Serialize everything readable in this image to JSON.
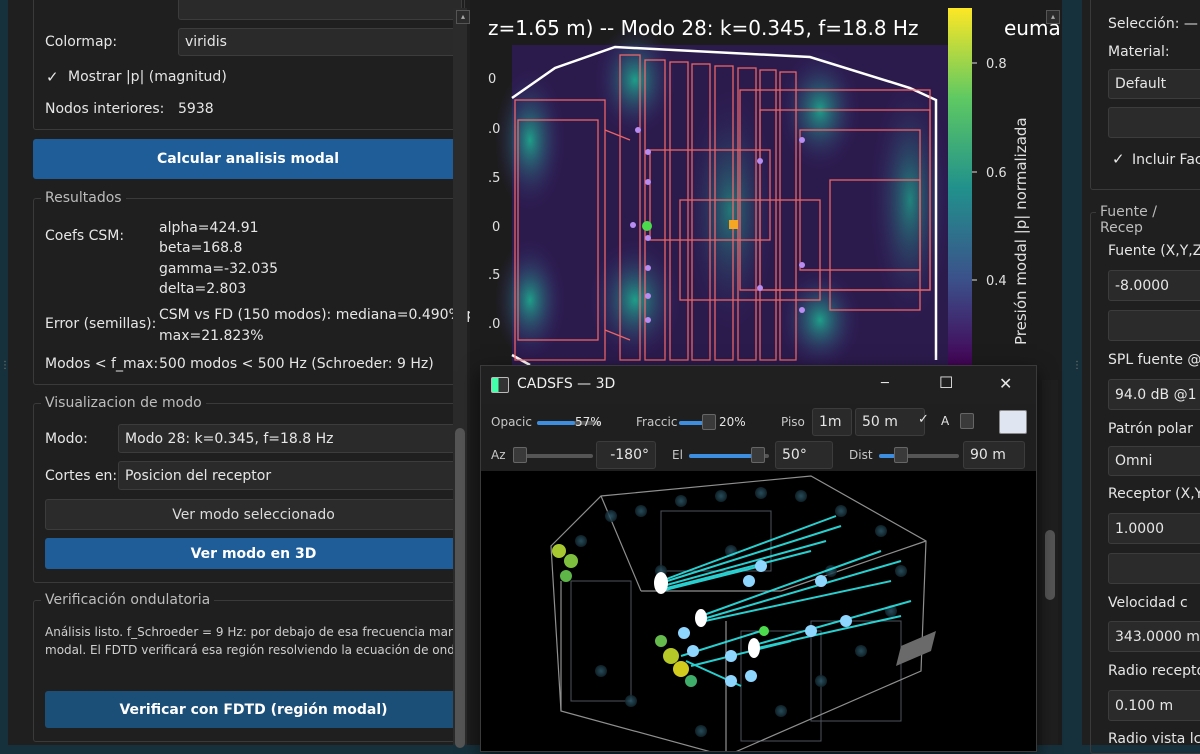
{
  "left": {
    "colormap_label": "Colormap:",
    "colormap_value": "viridis",
    "show_mag_label": "Mostrar |p| (magnitud)",
    "interior_nodes_label": "Nodos interiores:",
    "interior_nodes_value": "5938",
    "calc_button": "Calcular analisis modal",
    "results_title": "Resultados",
    "csm_label": "Coefs CSM:",
    "csm_values": [
      "alpha=424.91",
      "beta=168.8",
      "gamma=-32.035",
      "delta=2.803"
    ],
    "error_label": "Error (semillas):",
    "error_line1": "CSM vs FD (150 modos): mediana=0.490%  p",
    "error_line2": "max=21.823%",
    "modes_label": "Modos < f_max:",
    "modes_value": "500 modos < 500 Hz  (Schroeder: 9 Hz)",
    "viz_title": "Visualizacion de modo",
    "mode_label": "Modo:",
    "mode_value": "Modo 28: k=0.345, f=18.8 Hz",
    "cuts_label": "Cortes en:",
    "cuts_value": "Posicion del receptor",
    "view_mode_button": "Ver modo seleccionado",
    "view_3d_button": "Ver modo en 3D",
    "verif_title": "Verificación ondulatoria",
    "verif_line1": "Análisis listo. f_Schroeder = 9 Hz: por debajo de esa frecuencia man",
    "verif_line2": "modal. El FDTD verificará esa región resolviendo la ecuación de ond",
    "fdtd_button": "Verificar con FDTD (región modal)"
  },
  "plot": {
    "title": "z=1.65 m) -- Modo 28: k=0.345, f=18.8 Hz",
    "title_right": "eumar",
    "yticks": [
      ".0",
      ".5",
      "0",
      ".5",
      ".0"
    ],
    "colorbar_ticks": [
      "0.8",
      "0.6",
      "0.4"
    ],
    "colorbar_label": "Presión modal |p| normalizada"
  },
  "win3d": {
    "title": "CADSFS — 3D",
    "opacity_label": "Opacic",
    "opacity_value": "57%",
    "fraction_label": "Fraccic",
    "fraction_value": "20%",
    "floor_label": "Piso",
    "floor_step": "1m",
    "floor_value": "50 m",
    "a_label": "A",
    "az_label": "Az",
    "az_value": "-180°",
    "el_label": "El",
    "el_value": "50°",
    "dist_label": "Dist",
    "dist_value": "90 m",
    "colors": {
      "ray": "#2ee6e6",
      "bg": "#000000"
    }
  },
  "right": {
    "selection_label": "Selección: —",
    "material_label": "Material:",
    "material_value": "Default",
    "include_label": "Incluir Fac",
    "source_group": "Fuente / Recep",
    "source_label": "Fuente (X,Y,Z",
    "source_value": "-8.0000",
    "spl_label": "SPL fuente @",
    "spl_value": "94.0 dB @1",
    "polar_label": "Patrón polar",
    "polar_value": "Omni",
    "receiver_label": "Receptor (X,Y",
    "receiver_value": "1.0000",
    "speed_label": "Velocidad c",
    "speed_value": "343.0000 m",
    "radius_label": "Radio recepto",
    "radius_value": "0.100 m",
    "radius_view_label": "Radio vista lc"
  },
  "window_controls": {
    "minimize": "─",
    "maximize": "☐",
    "close": "✕"
  }
}
